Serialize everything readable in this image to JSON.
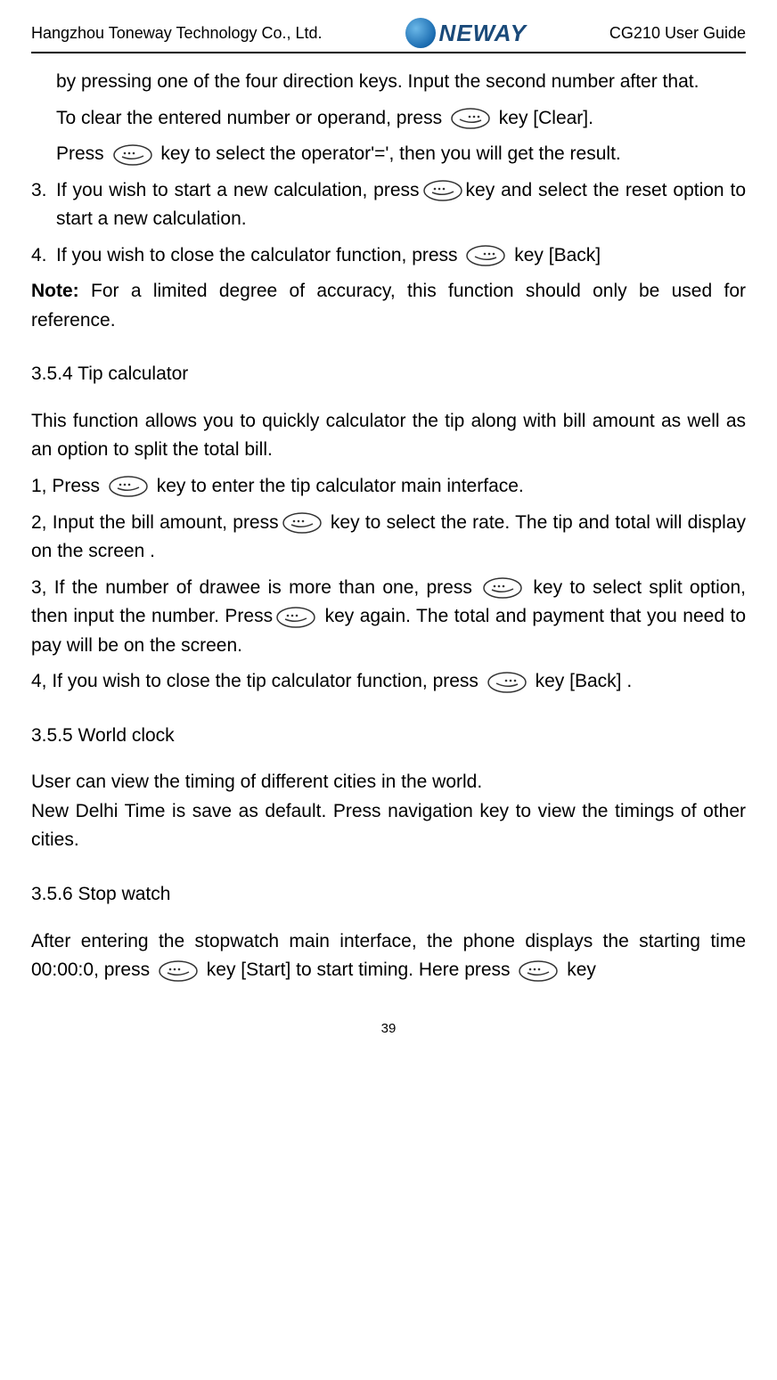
{
  "header": {
    "company": "Hangzhou Toneway Technology Co., Ltd.",
    "logo_text": "NEWAY",
    "guide": "CG210 User Guide"
  },
  "body": {
    "p1": "by pressing one of the four direction keys. Input the second number after that.",
    "p2a": "To clear the entered number or operand, press ",
    "p2b": " key [Clear].",
    "p3a": "Press ",
    "p3b": " key to select the operator'=', then you will get the result.",
    "li3_num": "3.",
    "li3a": "If you wish to start a new calculation, press",
    "li3b": "key and select the reset option to start a new calculation.",
    "li4_num": "4.",
    "li4a": "If you wish to close the calculator function, press ",
    "li4b": " key [Back]",
    "note_label": "Note:",
    "note_text": " For a limited degree of accuracy, this function should only be used for reference.",
    "h354": "3.5.4 Tip calculator",
    "tip_p1": "This function allows you to quickly calculator the tip along with bill amount as well as an option to split the total bill.",
    "tip_p2a": "1, Press ",
    "tip_p2b": " key to enter the tip calculator main interface.",
    "tip_p3a": "2, Input the bill amount, press",
    "tip_p3b": " key to select the rate. The tip and total will display on the screen .",
    "tip_p4a": "3, If the number of drawee is more than one, press ",
    "tip_p4b": " key to select split option, then input the number. Press",
    "tip_p4c": " key again. The total and payment that you need to pay will be on the screen.",
    "tip_p5a": "4, If you wish to close the tip calculator function, press ",
    "tip_p5b": " key [Back] .",
    "h355": "3.5.5 World clock",
    "wc_p1": "User can view the timing of different cities in the world.",
    "wc_p2": "New Delhi Time is save as default. Press navigation key to view the timings of other cities.",
    "h356": "3.5.6 Stop watch",
    "sw_p1a": "After entering the stopwatch main interface, the phone displays the starting time 00:00:0, press ",
    "sw_p1b": " key [Start] to start timing. Here press ",
    "sw_p1c": " key"
  },
  "page_number": "39"
}
